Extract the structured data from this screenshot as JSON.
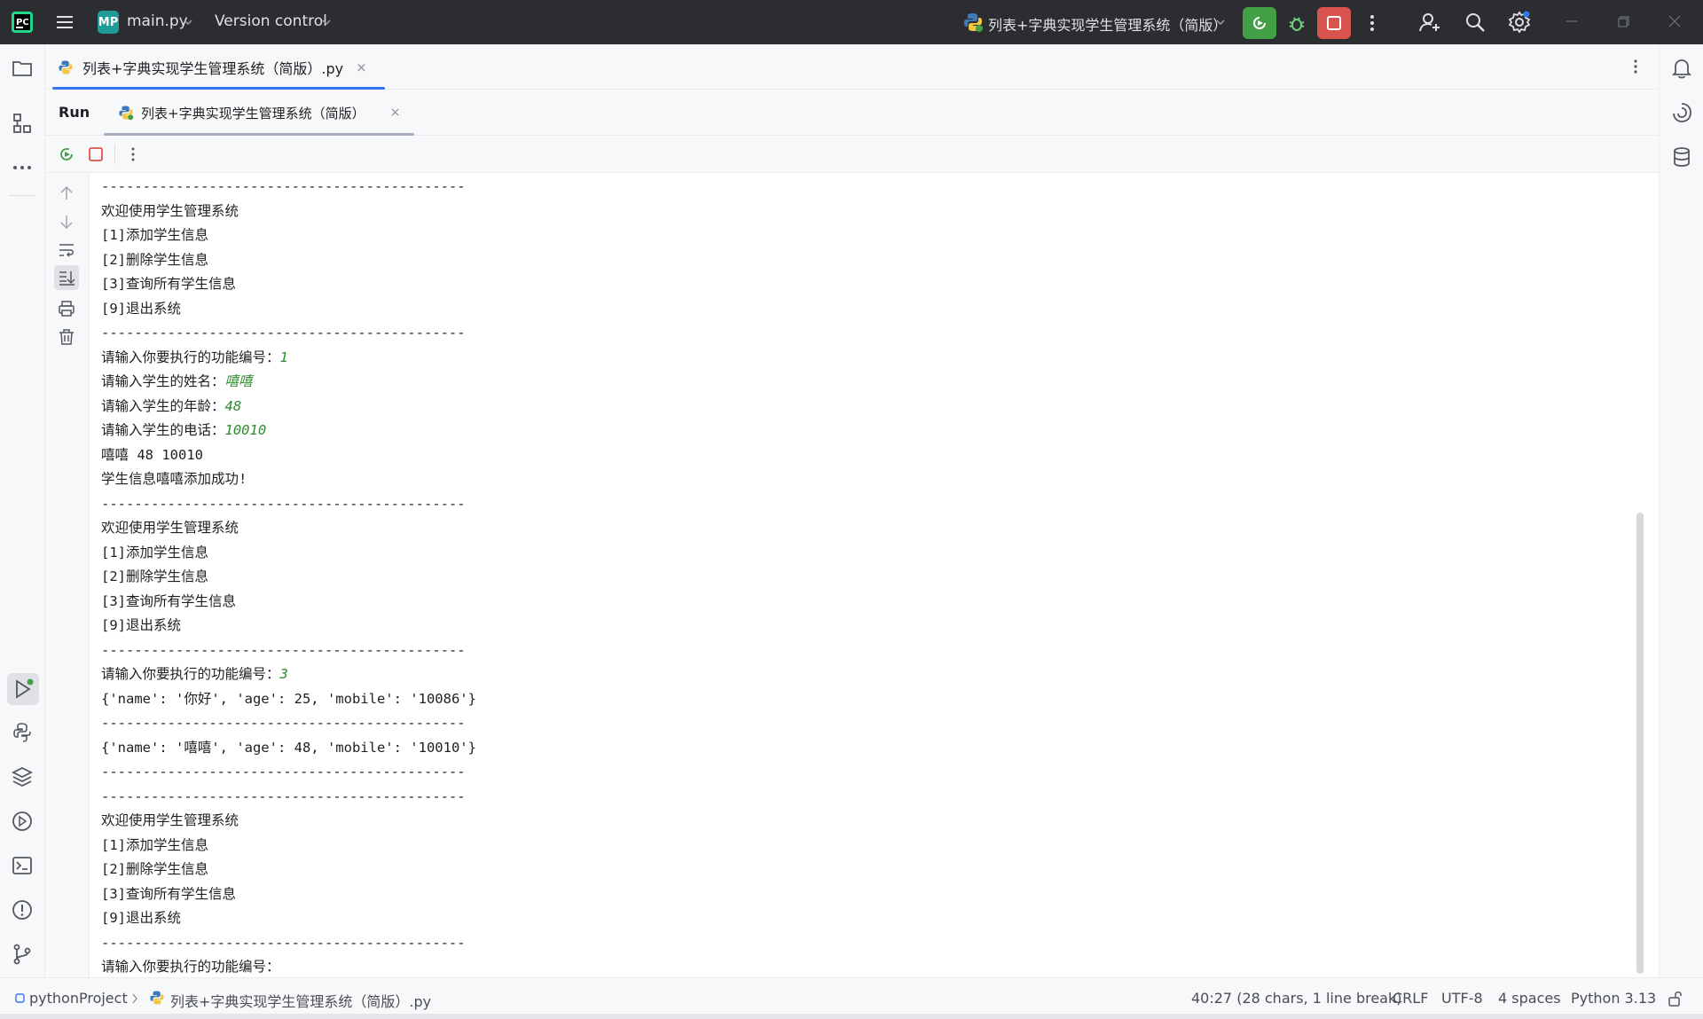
{
  "titlebar": {
    "project_badge": "MP",
    "project_name": "main.py",
    "vcs_label": "Version control",
    "run_config": "列表+字典实现学生管理系统（简版）"
  },
  "editor_tabs": [
    {
      "label": "列表+字典实现学生管理系统（简版）.py",
      "close": "×"
    }
  ],
  "run_panel": {
    "title": "Run",
    "tab_label": "列表+字典实现学生管理系统（简版）",
    "tab_close": "×"
  },
  "console": {
    "lines": [
      {
        "text": "--------------------------------------------",
        "input": ""
      },
      {
        "text": "欢迎使用学生管理系统",
        "input": ""
      },
      {
        "text": "[1]添加学生信息",
        "input": ""
      },
      {
        "text": "[2]删除学生信息",
        "input": ""
      },
      {
        "text": "[3]查询所有学生信息",
        "input": ""
      },
      {
        "text": "[9]退出系统",
        "input": ""
      },
      {
        "text": "--------------------------------------------",
        "input": ""
      },
      {
        "text": "请输入你要执行的功能编号：",
        "input": "1"
      },
      {
        "text": "请输入学生的姓名：",
        "input": "嘻嘻"
      },
      {
        "text": "请输入学生的年龄：",
        "input": "48"
      },
      {
        "text": "请输入学生的电话：",
        "input": "10010"
      },
      {
        "text": "嘻嘻 48 10010",
        "input": ""
      },
      {
        "text": "学生信息嘻嘻添加成功!",
        "input": ""
      },
      {
        "text": "--------------------------------------------",
        "input": ""
      },
      {
        "text": "欢迎使用学生管理系统",
        "input": ""
      },
      {
        "text": "[1]添加学生信息",
        "input": ""
      },
      {
        "text": "[2]删除学生信息",
        "input": ""
      },
      {
        "text": "[3]查询所有学生信息",
        "input": ""
      },
      {
        "text": "[9]退出系统",
        "input": ""
      },
      {
        "text": "--------------------------------------------",
        "input": ""
      },
      {
        "text": "请输入你要执行的功能编号：",
        "input": "3"
      },
      {
        "text": "{'name': '你好', 'age': 25, 'mobile': '10086'}",
        "input": ""
      },
      {
        "text": "--------------------------------------------",
        "input": ""
      },
      {
        "text": "{'name': '嘻嘻', 'age': 48, 'mobile': '10010'}",
        "input": ""
      },
      {
        "text": "--------------------------------------------",
        "input": ""
      },
      {
        "text": "--------------------------------------------",
        "input": ""
      },
      {
        "text": "欢迎使用学生管理系统",
        "input": ""
      },
      {
        "text": "[1]添加学生信息",
        "input": ""
      },
      {
        "text": "[2]删除学生信息",
        "input": ""
      },
      {
        "text": "[3]查询所有学生信息",
        "input": ""
      },
      {
        "text": "[9]退出系统",
        "input": ""
      },
      {
        "text": "--------------------------------------------",
        "input": ""
      },
      {
        "text": "请输入你要执行的功能编号：",
        "input": ""
      }
    ]
  },
  "statusbar": {
    "project": "pythonProject",
    "file": "列表+字典实现学生管理系统（简版）.py",
    "position": "40:27 (28 chars, 1 line break)",
    "line_ending": "CRLF",
    "encoding": "UTF-8",
    "indent": "4 spaces",
    "interpreter": "Python 3.13"
  },
  "colors": {
    "titlebar_bg": "#2b2d30",
    "accent": "#3574f0",
    "rerun_green": "#43a047",
    "stop_red": "#d9534f",
    "console_input": "#2f8a2f"
  },
  "icons": {
    "left_strip": [
      "folder-icon",
      "structure-icon",
      "more-icon",
      "run-icon",
      "python-packages-icon",
      "layers-icon",
      "services-icon",
      "terminal-icon",
      "problems-icon",
      "git-icon"
    ],
    "right_strip": [
      "notifications-icon",
      "ai-assistant-icon",
      "database-icon"
    ]
  }
}
